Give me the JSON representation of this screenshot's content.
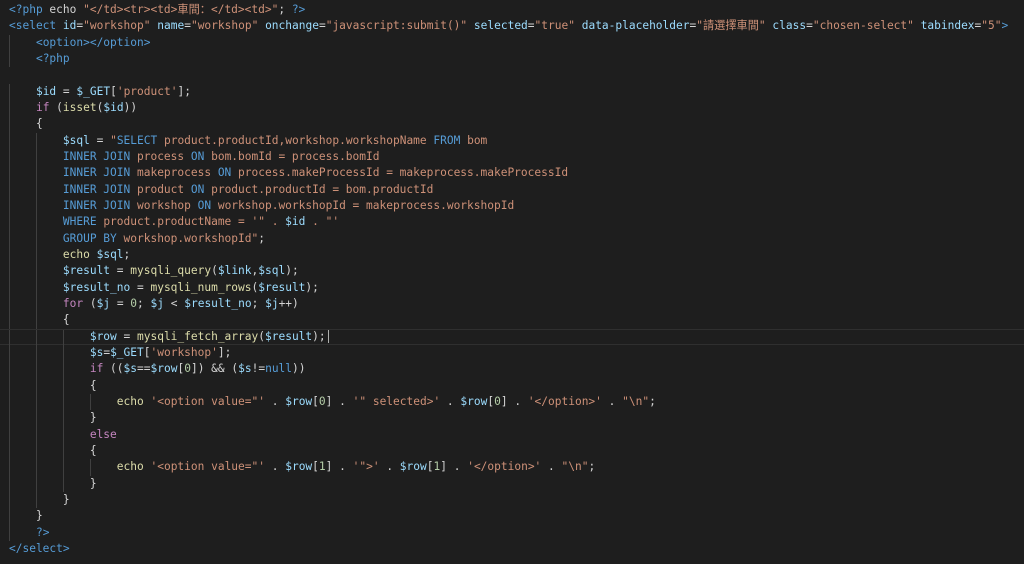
{
  "editor": {
    "lines": [
      [
        [
          "t-php",
          "<?php"
        ],
        [
          "t-plain",
          " echo "
        ],
        [
          "t-str",
          "\"</td><tr><td>車間：</td><td>\""
        ],
        [
          "t-plain",
          "; "
        ],
        [
          "t-php",
          "?>"
        ]
      ],
      [
        [
          "t-tag",
          "<select"
        ],
        [
          "t-plain",
          " "
        ],
        [
          "t-attr",
          "id"
        ],
        [
          "t-plain",
          "="
        ],
        [
          "t-str",
          "\"workshop\""
        ],
        [
          "t-plain",
          " "
        ],
        [
          "t-attr",
          "name"
        ],
        [
          "t-plain",
          "="
        ],
        [
          "t-str",
          "\"workshop\""
        ],
        [
          "t-plain",
          " "
        ],
        [
          "t-attr",
          "onchange"
        ],
        [
          "t-plain",
          "="
        ],
        [
          "t-str",
          "\"javascript:submit()\""
        ],
        [
          "t-plain",
          " "
        ],
        [
          "t-attr",
          "selected"
        ],
        [
          "t-plain",
          "="
        ],
        [
          "t-str",
          "\"true\""
        ],
        [
          "t-plain",
          " "
        ],
        [
          "t-attr",
          "data-placeholder"
        ],
        [
          "t-plain",
          "="
        ],
        [
          "t-str",
          "\"請選擇車間\""
        ],
        [
          "t-plain",
          " "
        ],
        [
          "t-attr",
          "class"
        ],
        [
          "t-plain",
          "="
        ],
        [
          "t-str",
          "\"chosen-select\""
        ],
        [
          "t-plain",
          " "
        ],
        [
          "t-attr",
          "tabindex"
        ],
        [
          "t-plain",
          "="
        ],
        [
          "t-str",
          "\"5\""
        ],
        [
          "t-tag",
          ">"
        ]
      ],
      [
        [
          "t-plain",
          "    "
        ],
        [
          "t-tag",
          "<option></option>"
        ]
      ],
      [
        [
          "t-plain",
          "    "
        ],
        [
          "t-php",
          "<?php"
        ]
      ],
      [
        [
          "t-plain",
          ""
        ]
      ],
      [
        [
          "t-plain",
          "    "
        ],
        [
          "t-var",
          "$id"
        ],
        [
          "t-plain",
          " = "
        ],
        [
          "t-var",
          "$_GET"
        ],
        [
          "t-plain",
          "["
        ],
        [
          "t-str",
          "'product'"
        ],
        [
          "t-plain",
          "];"
        ]
      ],
      [
        [
          "t-plain",
          "    "
        ],
        [
          "t-kw",
          "if"
        ],
        [
          "t-plain",
          " ("
        ],
        [
          "t-fn",
          "isset"
        ],
        [
          "t-plain",
          "("
        ],
        [
          "t-var",
          "$id"
        ],
        [
          "t-plain",
          "))"
        ]
      ],
      [
        [
          "t-plain",
          "    {"
        ]
      ],
      [
        [
          "t-plain",
          "        "
        ],
        [
          "t-var",
          "$sql"
        ],
        [
          "t-plain",
          " = "
        ],
        [
          "t-str",
          "\""
        ],
        [
          "t-sqlkw",
          "SELECT"
        ],
        [
          "t-str",
          " product.productId,workshop.workshopName "
        ],
        [
          "t-sqlkw",
          "FROM"
        ],
        [
          "t-str",
          " bom"
        ]
      ],
      [
        [
          "t-plain",
          "        "
        ],
        [
          "t-sqlkw",
          "INNER JOIN"
        ],
        [
          "t-str",
          " process "
        ],
        [
          "t-sqlkw",
          "ON"
        ],
        [
          "t-str",
          " bom.bomId = process.bomId"
        ]
      ],
      [
        [
          "t-plain",
          "        "
        ],
        [
          "t-sqlkw",
          "INNER JOIN"
        ],
        [
          "t-str",
          " makeprocess "
        ],
        [
          "t-sqlkw",
          "ON"
        ],
        [
          "t-str",
          " process.makeProcessId = makeprocess.makeProcessId"
        ]
      ],
      [
        [
          "t-plain",
          "        "
        ],
        [
          "t-sqlkw",
          "INNER JOIN"
        ],
        [
          "t-str",
          " product "
        ],
        [
          "t-sqlkw",
          "ON"
        ],
        [
          "t-str",
          " product.productId = bom.productId"
        ]
      ],
      [
        [
          "t-plain",
          "        "
        ],
        [
          "t-sqlkw",
          "INNER JOIN"
        ],
        [
          "t-str",
          " workshop "
        ],
        [
          "t-sqlkw",
          "ON"
        ],
        [
          "t-str",
          " workshop.workshopId = makeprocess.workshopId"
        ]
      ],
      [
        [
          "t-plain",
          "        "
        ],
        [
          "t-sqlkw",
          "WHERE"
        ],
        [
          "t-str",
          " product.productName = '\" . "
        ],
        [
          "t-var",
          "$id"
        ],
        [
          "t-str",
          " . \"'"
        ]
      ],
      [
        [
          "t-plain",
          "        "
        ],
        [
          "t-sqlkw",
          "GROUP BY"
        ],
        [
          "t-str",
          " workshop.workshopId\""
        ],
        [
          "t-plain",
          ";"
        ]
      ],
      [
        [
          "t-plain",
          "        "
        ],
        [
          "t-fn",
          "echo"
        ],
        [
          "t-plain",
          " "
        ],
        [
          "t-var",
          "$sql"
        ],
        [
          "t-plain",
          ";"
        ]
      ],
      [
        [
          "t-plain",
          "        "
        ],
        [
          "t-var",
          "$result"
        ],
        [
          "t-plain",
          " = "
        ],
        [
          "t-fn",
          "mysqli_query"
        ],
        [
          "t-plain",
          "("
        ],
        [
          "t-var",
          "$link"
        ],
        [
          "t-plain",
          ","
        ],
        [
          "t-var",
          "$sql"
        ],
        [
          "t-plain",
          ");"
        ]
      ],
      [
        [
          "t-plain",
          "        "
        ],
        [
          "t-var",
          "$result_no"
        ],
        [
          "t-plain",
          " = "
        ],
        [
          "t-fn",
          "mysqli_num_rows"
        ],
        [
          "t-plain",
          "("
        ],
        [
          "t-var",
          "$result"
        ],
        [
          "t-plain",
          ");"
        ]
      ],
      [
        [
          "t-plain",
          "        "
        ],
        [
          "t-kw",
          "for"
        ],
        [
          "t-plain",
          " ("
        ],
        [
          "t-var",
          "$j"
        ],
        [
          "t-plain",
          " = "
        ],
        [
          "t-num",
          "0"
        ],
        [
          "t-plain",
          "; "
        ],
        [
          "t-var",
          "$j"
        ],
        [
          "t-plain",
          " < "
        ],
        [
          "t-var",
          "$result_no"
        ],
        [
          "t-plain",
          "; "
        ],
        [
          "t-var",
          "$j"
        ],
        [
          "t-plain",
          "++)"
        ]
      ],
      [
        [
          "t-plain",
          "        {"
        ]
      ],
      [
        [
          "t-plain",
          "            "
        ],
        [
          "t-var",
          "$row"
        ],
        [
          "t-plain",
          " = "
        ],
        [
          "t-fn",
          "mysqli_fetch_array"
        ],
        [
          "t-plain",
          "("
        ],
        [
          "t-var",
          "$result"
        ],
        [
          "t-plain",
          ");"
        ]
      ],
      [
        [
          "t-plain",
          "            "
        ],
        [
          "t-var",
          "$s"
        ],
        [
          "t-plain",
          "="
        ],
        [
          "t-var",
          "$_GET"
        ],
        [
          "t-plain",
          "["
        ],
        [
          "t-str",
          "'workshop'"
        ],
        [
          "t-plain",
          "];"
        ]
      ],
      [
        [
          "t-plain",
          "            "
        ],
        [
          "t-kw",
          "if"
        ],
        [
          "t-plain",
          " (("
        ],
        [
          "t-var",
          "$s"
        ],
        [
          "t-plain",
          "=="
        ],
        [
          "t-var",
          "$row"
        ],
        [
          "t-plain",
          "["
        ],
        [
          "t-num",
          "0"
        ],
        [
          "t-plain",
          "]) && ("
        ],
        [
          "t-var",
          "$s"
        ],
        [
          "t-plain",
          "!="
        ],
        [
          "t-sqlkw",
          "null"
        ],
        [
          "t-plain",
          "))"
        ]
      ],
      [
        [
          "t-plain",
          "            {"
        ]
      ],
      [
        [
          "t-plain",
          "                "
        ],
        [
          "t-fn",
          "echo"
        ],
        [
          "t-plain",
          " "
        ],
        [
          "t-str",
          "'<option value=\"'"
        ],
        [
          "t-plain",
          " . "
        ],
        [
          "t-var",
          "$row"
        ],
        [
          "t-plain",
          "["
        ],
        [
          "t-num",
          "0"
        ],
        [
          "t-plain",
          "] . "
        ],
        [
          "t-str",
          "'\" selected>'"
        ],
        [
          "t-plain",
          " . "
        ],
        [
          "t-var",
          "$row"
        ],
        [
          "t-plain",
          "["
        ],
        [
          "t-num",
          "0"
        ],
        [
          "t-plain",
          "] . "
        ],
        [
          "t-str",
          "'</option>'"
        ],
        [
          "t-plain",
          " . "
        ],
        [
          "t-str",
          "\"\\n\""
        ],
        [
          "t-plain",
          ";"
        ]
      ],
      [
        [
          "t-plain",
          "            }"
        ]
      ],
      [
        [
          "t-plain",
          "            "
        ],
        [
          "t-kw",
          "else"
        ]
      ],
      [
        [
          "t-plain",
          "            {"
        ]
      ],
      [
        [
          "t-plain",
          "                "
        ],
        [
          "t-fn",
          "echo"
        ],
        [
          "t-plain",
          " "
        ],
        [
          "t-str",
          "'<option value=\"'"
        ],
        [
          "t-plain",
          " . "
        ],
        [
          "t-var",
          "$row"
        ],
        [
          "t-plain",
          "["
        ],
        [
          "t-num",
          "1"
        ],
        [
          "t-plain",
          "] . "
        ],
        [
          "t-str",
          "'\">'"
        ],
        [
          "t-plain",
          " . "
        ],
        [
          "t-var",
          "$row"
        ],
        [
          "t-plain",
          "["
        ],
        [
          "t-num",
          "1"
        ],
        [
          "t-plain",
          "] . "
        ],
        [
          "t-str",
          "'</option>'"
        ],
        [
          "t-plain",
          " . "
        ],
        [
          "t-str",
          "\"\\n\""
        ],
        [
          "t-plain",
          ";"
        ]
      ],
      [
        [
          "t-plain",
          "            }"
        ]
      ],
      [
        [
          "t-plain",
          "        }"
        ]
      ],
      [
        [
          "t-plain",
          "    }"
        ]
      ],
      [
        [
          "t-plain",
          "    "
        ],
        [
          "t-php",
          "?>"
        ]
      ],
      [
        [
          "t-tag",
          "</select>"
        ]
      ]
    ],
    "cursor_line": 21,
    "colors": {
      "background": "#1e1e1e",
      "tag": "#569cd6",
      "attribute": "#9cdcfe",
      "string": "#ce9178",
      "variable": "#9cdcfe",
      "keyword": "#c586c0",
      "function": "#dcdcaa",
      "number": "#b5cea8",
      "plain": "#d4d4d4"
    }
  }
}
